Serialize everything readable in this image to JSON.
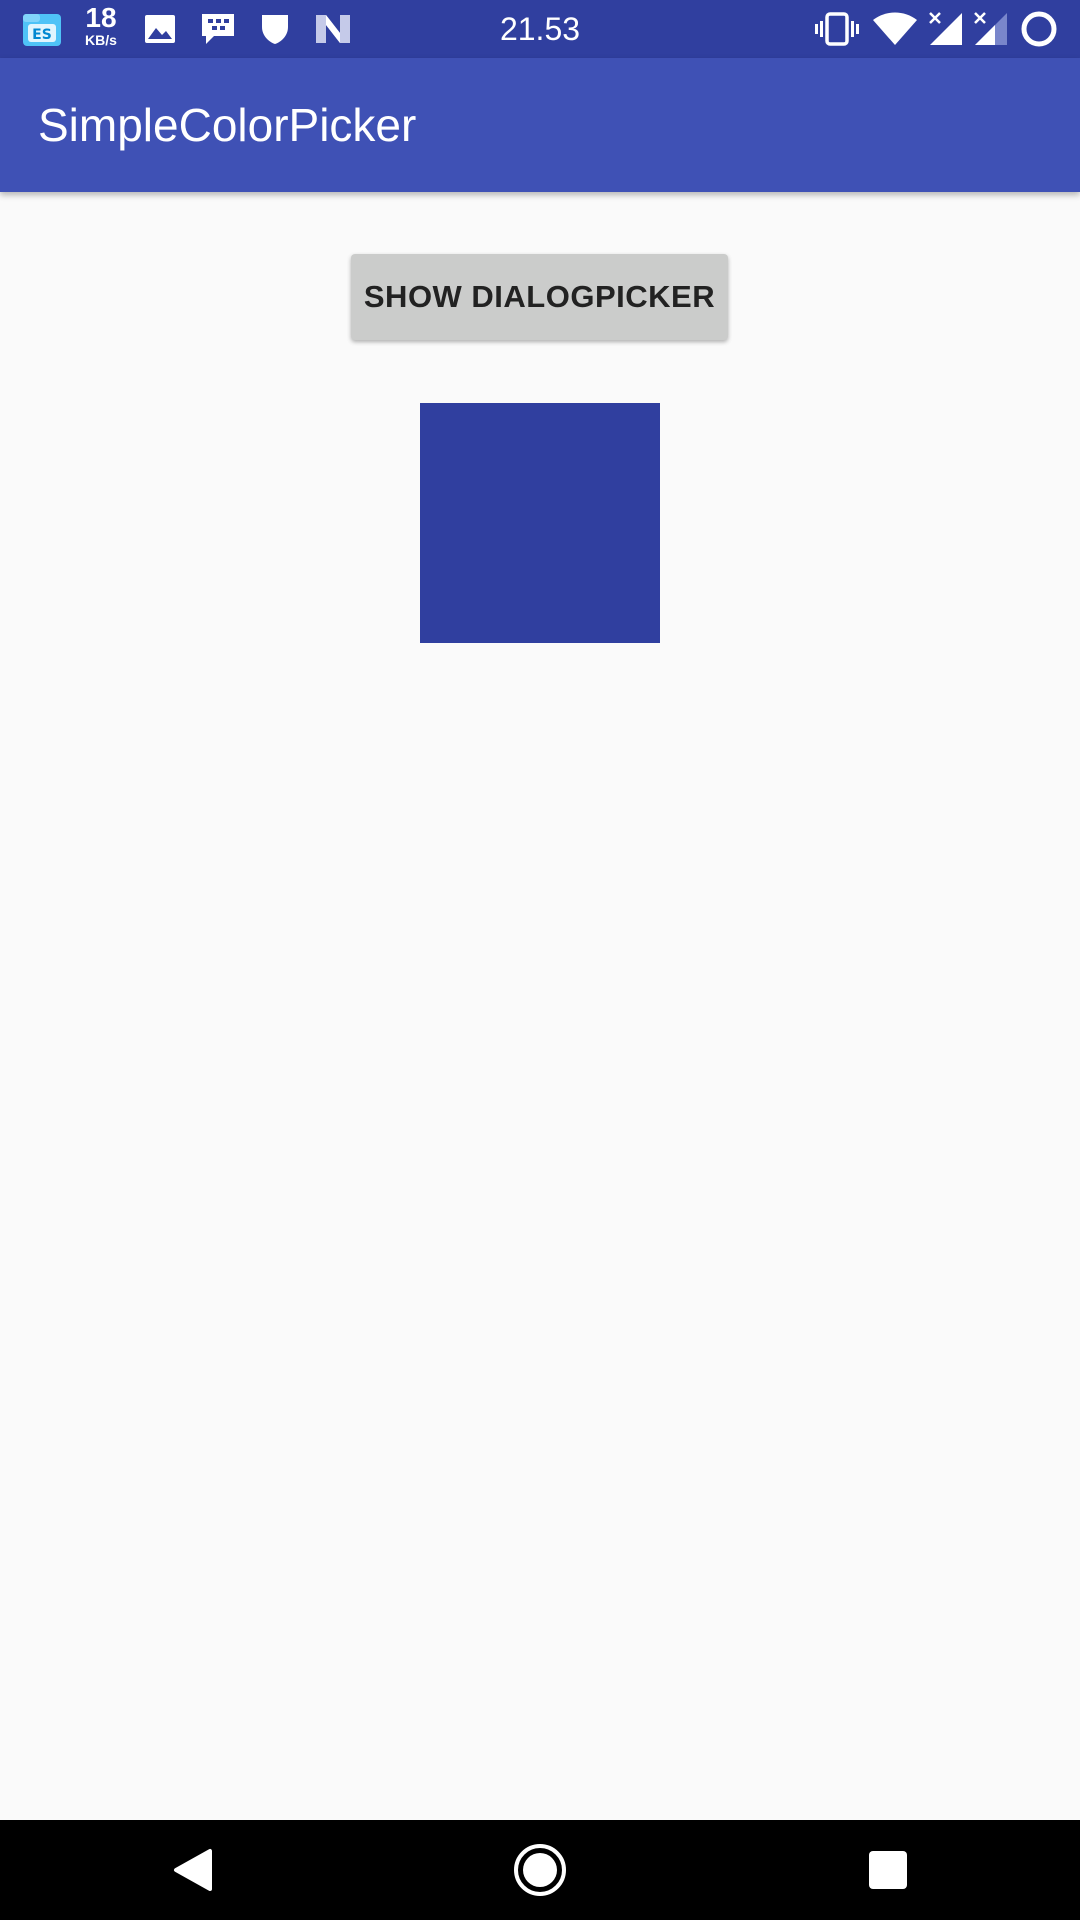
{
  "status_bar": {
    "net_speed_value": "18",
    "net_speed_unit": "KB/s",
    "time": "21.53",
    "left_icons": [
      "file-manager-icon",
      "net-speed",
      "image-icon",
      "bbm-chat-icon",
      "shield-icon",
      "n-logo-icon"
    ],
    "right_icons": [
      "vibrate-icon",
      "wifi-icon",
      "signal-icon",
      "signal-icon",
      "ring-icon"
    ],
    "background": "#303f9f"
  },
  "app_bar": {
    "title": "SimpleColorPicker",
    "background": "#3f51b5"
  },
  "main": {
    "show_button_label": "SHOW DIALOGPICKER",
    "selected_color": "#303f9f"
  },
  "nav_bar": {
    "icons": [
      "back-icon",
      "home-icon",
      "recents-icon"
    ]
  }
}
